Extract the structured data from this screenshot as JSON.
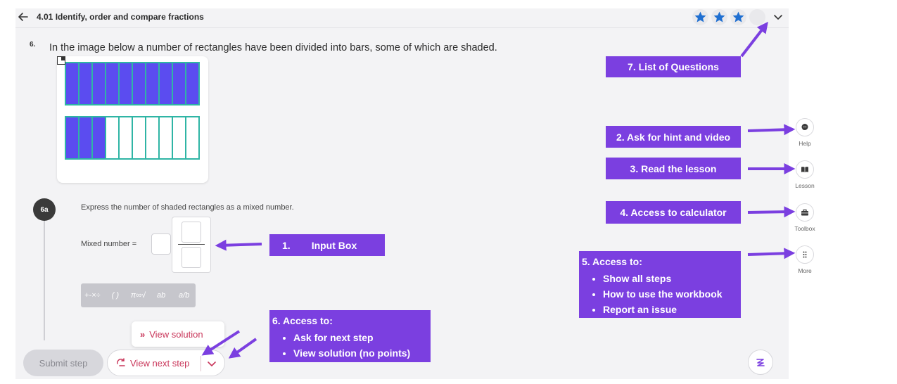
{
  "header": {
    "title": "4.01 Identify, order and compare fractions",
    "stars_filled": 3,
    "stars_total": 4
  },
  "question": {
    "number": "6.",
    "text": "In the image below a number of rectangles have been divided into bars, some of which are shaded."
  },
  "figure": {
    "rectangles": [
      {
        "bars": 10,
        "shaded": 10
      },
      {
        "bars": 10,
        "shaded": 3
      }
    ],
    "colors": {
      "shaded": "#5b4cf0",
      "border": "#2fb5a5",
      "unshaded": "#ffffff"
    }
  },
  "step": {
    "badge": "6a",
    "prompt": "Express the number of shaded rectangles as a mixed number.",
    "answer_label": "Mixed number ="
  },
  "math_toolbar": {
    "buttons": [
      "+-×÷",
      "( )",
      "π∞√",
      "ab",
      "a/b"
    ]
  },
  "actions": {
    "view_solution": "View solution",
    "submit": "Submit step",
    "view_next_step": "View next step"
  },
  "sidebar": {
    "items": [
      {
        "label": "Help",
        "icon": "chat-icon"
      },
      {
        "label": "Lesson",
        "icon": "book-icon"
      },
      {
        "label": "Toolbox",
        "icon": "toolbox-icon"
      },
      {
        "label": "More",
        "icon": "dots-grid-icon"
      }
    ]
  },
  "callouts": {
    "input_box": {
      "number": "1.",
      "text": "Input Box"
    },
    "hint": "2. Ask for hint and video",
    "lesson": "3. Read the lesson",
    "calculator": "4. Access to calculator",
    "more": {
      "heading": "5. Access to:",
      "items": [
        "Show all steps",
        "How to use the workbook",
        "Report an issue"
      ]
    },
    "next_step": {
      "heading": "6.  Access to:",
      "items": [
        "Ask for next step",
        "View solution (no points)"
      ]
    },
    "questions": "7. List of Questions"
  },
  "colors": {
    "callout_bg": "#7b3fe0",
    "accent_red": "#c9365a",
    "star_blue": "#1f6fd1"
  }
}
